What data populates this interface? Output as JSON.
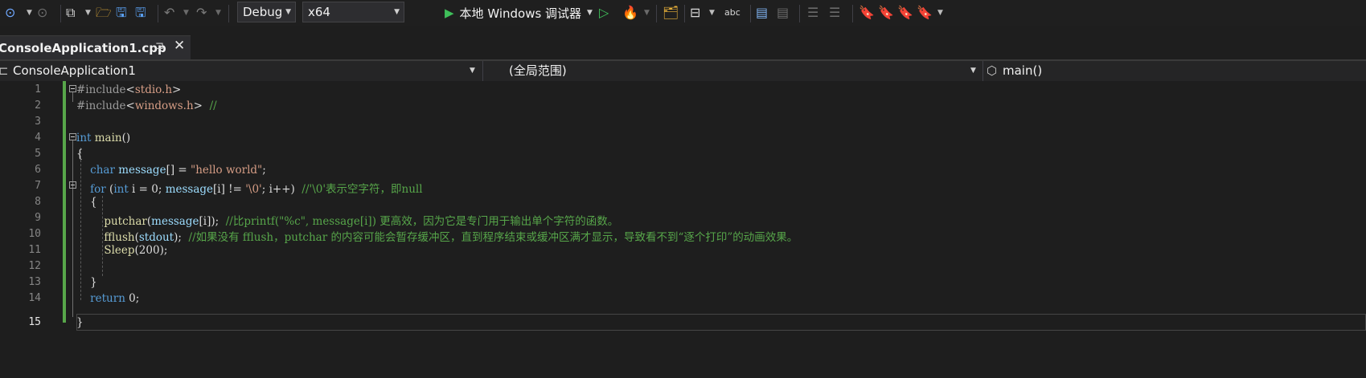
{
  "toolbar": {
    "config": "Debug",
    "platform": "x64",
    "run_label": "本地 Windows 调试器",
    "icons": [
      "back-icon",
      "forward-icon",
      "new-project-icon",
      "open-folder-icon",
      "save-icon",
      "save-all-icon",
      "undo-icon",
      "redo-icon",
      "start-without-debug-icon",
      "hot-reload-icon",
      "solution-explorer-icon",
      "layout-icon",
      "spell-check-icon",
      "comment-icon",
      "uncomment-icon",
      "outdent-icon",
      "indent-icon",
      "bookmark-icon",
      "prev-bookmark-icon",
      "next-bookmark-icon",
      "clear-bookmarks-icon"
    ]
  },
  "tab": {
    "title": "ConsoleApplication1.cpp",
    "pin": "⊐",
    "close": "✕"
  },
  "navbar": {
    "project": "ConsoleApplication1",
    "scope": "(全局范围)",
    "member": "main()"
  },
  "editor": {
    "line_numbers": [
      "1",
      "2",
      "3",
      "4",
      "5",
      "6",
      "7",
      "8",
      "9",
      "10",
      "11",
      "12",
      "13",
      "14",
      "15"
    ],
    "lines": [
      "#include<stdio.h>",
      "#include<windows.h>  //",
      "",
      "int main()",
      "{",
      "    char message[] = \"hello world\";",
      "    for (int i = 0; message[i] != '\\0'; i++)  //'\\0'表示空字符，即null",
      "    {",
      "        putchar(message[i]);  //比printf(\"%c\", message[i]) 更高效，因为它是专门用于输出单个字符的函数。",
      "        fflush(stdout);  //如果没有 fflush，putchar 的内容可能会暂存缓冲区，直到程序结束或缓冲区满才显示，导致看不到“逐个打印”的动画效果。",
      "        Sleep(200);",
      "",
      "    }",
      "    return 0;",
      "}"
    ]
  },
  "colors": {
    "keyword": "#569cd6",
    "string": "#d69d85",
    "comment": "#57a64a",
    "change_bar": "#57a64a",
    "background": "#1e1e1e"
  }
}
